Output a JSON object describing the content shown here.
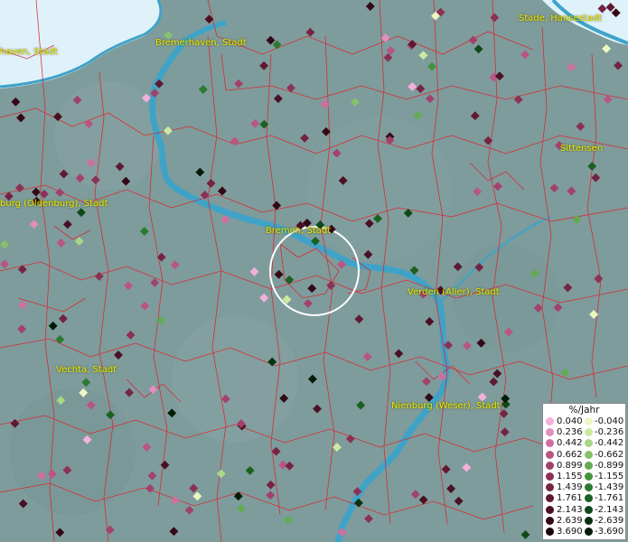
{
  "cities": [
    {
      "id": "bremerhaven",
      "label": "Bremerhaven, Stadt"
    },
    {
      "id": "stade",
      "label": "Stade, Hansestadt"
    },
    {
      "id": "cuxhaven-partial",
      "label": "haven, Stadt"
    },
    {
      "id": "sittensen",
      "label": "Sittensen"
    },
    {
      "id": "oldenburg-partial",
      "label": "burg (Oldenburg), Stadt"
    },
    {
      "id": "bremen",
      "label": "Bremen, Stadt"
    },
    {
      "id": "verden",
      "label": "Verden (Aller), Stadt"
    },
    {
      "id": "vechta",
      "label": "Vechta, Stadt"
    },
    {
      "id": "nienburg",
      "label": "Nienburg (Weser), Stadt"
    }
  ],
  "legend": {
    "title": "%/Jahr",
    "positive": [
      {
        "label": "0.040",
        "color": "#f4b0dc"
      },
      {
        "label": "0.236",
        "color": "#e28ebf"
      },
      {
        "label": "0.442",
        "color": "#cf6f9f"
      },
      {
        "label": "0.662",
        "color": "#b95583"
      },
      {
        "label": "0.899",
        "color": "#a2426c"
      },
      {
        "label": "1.155",
        "color": "#8b3156"
      },
      {
        "label": "1.439",
        "color": "#742442"
      },
      {
        "label": "1.761",
        "color": "#5f1932"
      },
      {
        "label": "2.143",
        "color": "#4a1023"
      },
      {
        "label": "2.639",
        "color": "#340917"
      },
      {
        "label": "3.690",
        "color": "#1c040c"
      }
    ],
    "negative": [
      {
        "label": "-0.040",
        "color": "#eef7c2"
      },
      {
        "label": "-0.236",
        "color": "#cde9a1"
      },
      {
        "label": "-0.442",
        "color": "#a9d784"
      },
      {
        "label": "-0.662",
        "color": "#86c26a"
      },
      {
        "label": "-0.899",
        "color": "#62ab52"
      },
      {
        "label": "-1.155",
        "color": "#43933f"
      },
      {
        "label": "-1.439",
        "color": "#2c7a30"
      },
      {
        "label": "-1.761",
        "color": "#1a6122"
      },
      {
        "label": "-2.143",
        "color": "#0e4918"
      },
      {
        "label": "-2.639",
        "color": "#06330e"
      },
      {
        "label": "-3.690",
        "color": "#021c06"
      }
    ]
  },
  "colors": {
    "land": "#7e9c9c",
    "water": "#3fa3c8",
    "sea_ice": "#dff2fa",
    "boundary": "#e0202a",
    "city_label": "#e8e800",
    "selection_circle": "#ffffff"
  }
}
